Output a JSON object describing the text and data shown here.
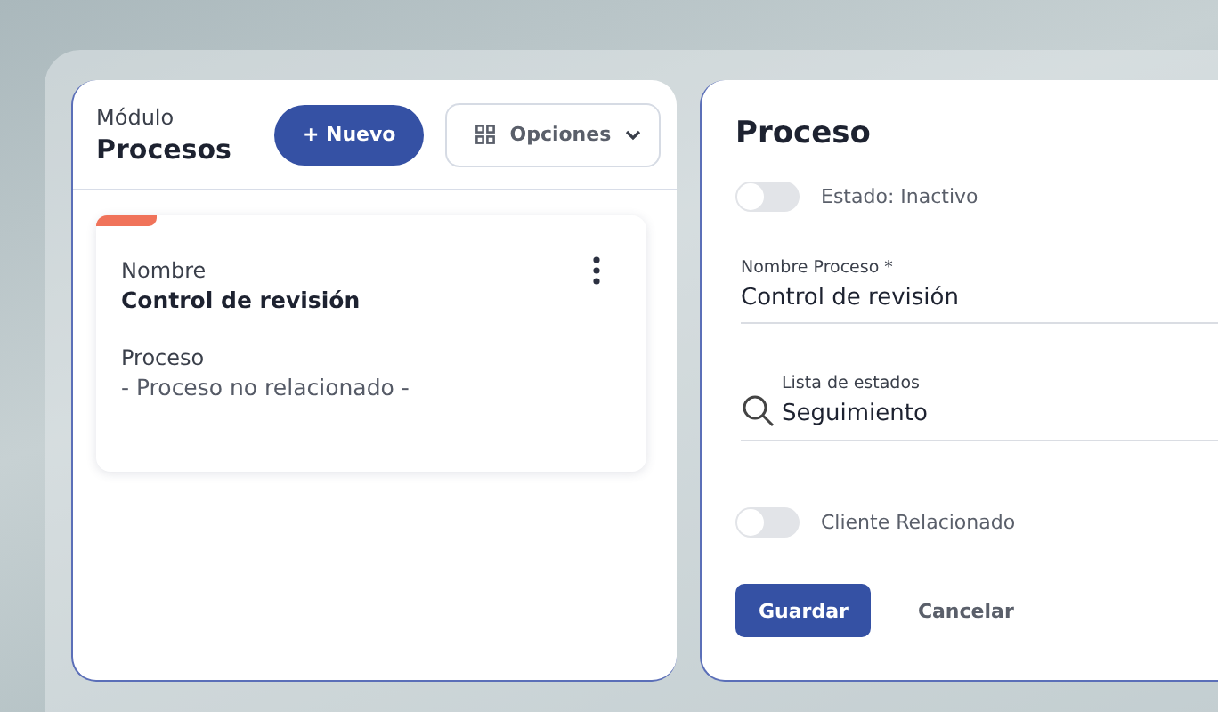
{
  "list_panel": {
    "caption": "Módulo",
    "title": "Procesos",
    "new_button": "+ Nuevo",
    "options_button": "Opciones",
    "cards": [
      {
        "color": "#f0735a",
        "fields": [
          {
            "label": "Nombre",
            "value": "Control de revisión",
            "kind": "bold"
          },
          {
            "label": "Proceso",
            "value": "- Proceso no relacionado -",
            "kind": "muted"
          }
        ]
      }
    ]
  },
  "form_panel": {
    "title": "Proceso",
    "rows": [
      {
        "kind": "toggle",
        "label": "Estado: Inactivo",
        "on": false
      },
      {
        "kind": "text",
        "label": "Nombre Proceso *",
        "value": "Control de revisión"
      },
      {
        "kind": "search",
        "label": "Lista de estados",
        "value": "Seguimiento"
      },
      {
        "kind": "toggle",
        "label": "Cliente Relacionado",
        "on": false
      }
    ],
    "save_button": "Guardar",
    "cancel_button": "Cancelar"
  }
}
